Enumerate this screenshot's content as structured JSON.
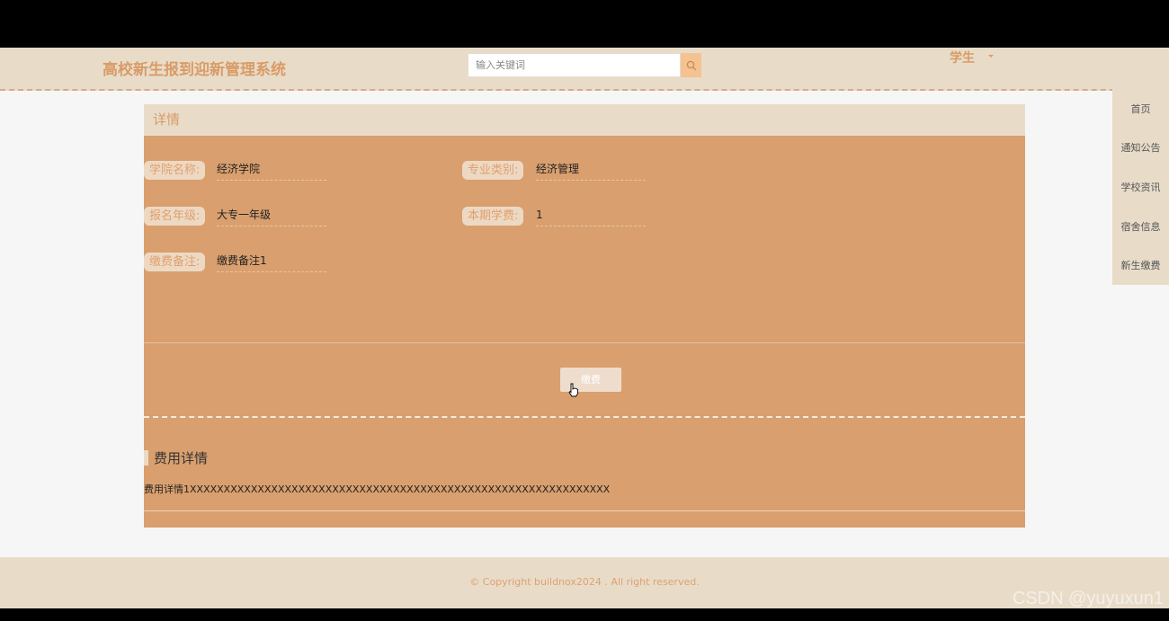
{
  "header": {
    "title": "高校新生报到迎新管理系统",
    "search_placeholder": "输入关键词",
    "user": "学生"
  },
  "nav": [
    "首页",
    "通知公告",
    "学校资讯",
    "宿舍信息",
    "新生缴费"
  ],
  "panel": {
    "title": "详情",
    "fields": [
      {
        "label": "学院名称:",
        "value": "经济学院"
      },
      {
        "label": "专业类别:",
        "value": "经济管理"
      },
      {
        "label": "报名年级:",
        "value": "大专一年级"
      },
      {
        "label": "本期学费:",
        "value": "1"
      },
      {
        "label": "缴费备注:",
        "value": "缴费备注1"
      }
    ],
    "pay_button": "缴费",
    "section_title": "费用详情",
    "detail_text": "费用详情1XXXXXXXXXXXXXXXXXXXXXXXXXXXXXXXXXXXXXXXXXXXXXXXXXXXXXXXXXXXXXX"
  },
  "footer": {
    "copyright": "© Copyright buildnox2024 . All right reserved."
  },
  "watermark": "CSDN @yuyuxun1",
  "colors": {
    "header_bg": "#e8dcc9",
    "panel_bg": "#d99f6e",
    "accent": "#d99b66"
  }
}
